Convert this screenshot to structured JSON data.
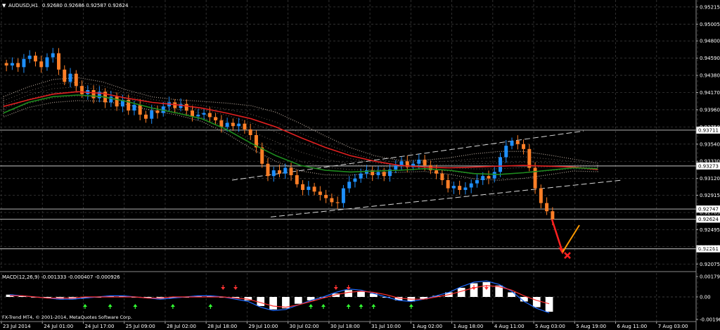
{
  "chart_header": {
    "symbol_label": "AUDUSD,H1",
    "ohlc_text": "0.92680 0.92686 0.92587 0.92624"
  },
  "watermark": "FX-Trend MT4, © 2001-2014, MetaQuotes Software Corp.",
  "chart_data": [
    {
      "type": "candlestick",
      "symbol": "AUDUSD",
      "timeframe": "H1",
      "last_bar": {
        "open": 0.9268,
        "high": 0.92686,
        "low": 0.92587,
        "close": 0.92624
      },
      "x_tick_labels": [
        "23 Jul 2014",
        "24 Jul 01:00",
        "24 Jul 17:00",
        "25 Jul 09:00",
        "28 Jul 02:00",
        "28 Jul 18:00",
        "29 Jul 10:00",
        "30 Jul 02:00",
        "30 Jul 18:00",
        "31 Jul 10:00",
        "1 Aug 02:00",
        "1 Aug 18:00",
        "4 Aug 11:00",
        "5 Aug 03:00",
        "5 Aug 19:00",
        "6 Aug 11:00",
        "7 Aug 03:00"
      ],
      "y_tick_labels": [
        "0.95215",
        "0.95005",
        "0.94800",
        "0.94590",
        "0.94380",
        "0.94170",
        "0.93960",
        "0.93750",
        "0.93540",
        "0.93330",
        "0.93120",
        "0.92915",
        "0.92705",
        "0.92495",
        "0.92285",
        "0.92075"
      ],
      "ylim": [
        0.92,
        0.953
      ],
      "horizontal_levels": [
        {
          "label": "0.93711",
          "value": 0.93711
        },
        {
          "label": "0.93273",
          "value": 0.93273
        },
        {
          "label": "0.92747",
          "value": 0.92747
        },
        {
          "label": "0.92624",
          "value": 0.92624
        },
        {
          "label": "0.92261",
          "value": 0.92261
        }
      ],
      "close_series": [
        0.945,
        0.9453,
        0.9448,
        0.9458,
        0.9462,
        0.9455,
        0.9448,
        0.946,
        0.9465,
        0.9445,
        0.943,
        0.944,
        0.9425,
        0.9415,
        0.942,
        0.941,
        0.9418,
        0.9405,
        0.9412,
        0.94,
        0.9408,
        0.9395,
        0.9402,
        0.939,
        0.9385,
        0.9395,
        0.9392,
        0.94,
        0.9405,
        0.9398,
        0.9403,
        0.9395,
        0.9388,
        0.939,
        0.9392,
        0.9387,
        0.9383,
        0.9375,
        0.938,
        0.9376,
        0.9379,
        0.9372,
        0.9365,
        0.935,
        0.933,
        0.9315,
        0.9322,
        0.9318,
        0.9325,
        0.9316,
        0.9305,
        0.9298,
        0.9302,
        0.9296,
        0.9292,
        0.9288,
        0.9283,
        0.9282,
        0.93,
        0.9308,
        0.9312,
        0.9318,
        0.9322,
        0.9316,
        0.932,
        0.9315,
        0.9323,
        0.9328,
        0.9333,
        0.9326,
        0.933,
        0.9335,
        0.9328,
        0.9322,
        0.9318,
        0.931,
        0.93,
        0.9303,
        0.9298,
        0.9301,
        0.9306,
        0.931,
        0.9315,
        0.9312,
        0.932,
        0.9338,
        0.9352,
        0.9358,
        0.9354,
        0.9348,
        0.9325,
        0.93,
        0.9282,
        0.9272,
        0.9262
      ],
      "moving_averages": [
        {
          "color": "#e02020",
          "values": [
            0.94,
            0.9408,
            0.9415,
            0.9418,
            0.9416,
            0.941,
            0.9405,
            0.9402,
            0.9398,
            0.9392,
            0.9385,
            0.9375,
            0.9362,
            0.935,
            0.934,
            0.9333,
            0.9328,
            0.9326,
            0.9325,
            0.9326,
            0.9327,
            0.9328,
            0.9327,
            0.9326,
            0.9323
          ]
        },
        {
          "color": "#1e8c1e",
          "values": [
            0.9392,
            0.9405,
            0.9412,
            0.9414,
            0.9412,
            0.9406,
            0.9398,
            0.9392,
            0.9385,
            0.9372,
            0.9355,
            0.934,
            0.9328,
            0.9322,
            0.932,
            0.9321,
            0.9322,
            0.9324,
            0.9322,
            0.9318,
            0.9317,
            0.9319,
            0.9322,
            0.9325,
            0.9324
          ]
        }
      ],
      "channel": {
        "lower_start": 0.9265,
        "lower_end": 0.931,
        "upper_start": 0.931,
        "upper_end": 0.937
      },
      "forecast": {
        "red_arrow_from": 0.9262,
        "red_arrow_to": 0.9222,
        "orange_line_from": 0.9222,
        "orange_line_to": 0.9255,
        "cross_marker": 0.9218
      }
    },
    {
      "type": "histogram",
      "indicator_label": "MACD(12,26,9) -0.001333 -0.000407 -0.000926",
      "y_tick_labels": [
        "0.001797",
        "0.00",
        "-0.001966"
      ],
      "ylim": [
        -0.0021,
        0.0021
      ],
      "histogram": [
        0.0002,
        0.0001,
        0.0,
        -0.0001,
        -0.0002,
        -0.0002,
        -0.0001,
        0.0,
        0.0001,
        0.0001,
        0.0,
        -0.0001,
        -0.0002,
        -0.0001,
        0.0,
        0.0001,
        0.0001,
        0.0,
        -0.0001,
        -0.0003,
        -0.0008,
        -0.0011,
        -0.001,
        -0.0006,
        -0.0003,
        0.0,
        0.0003,
        0.0006,
        0.0005,
        0.0003,
        0.0,
        -0.0003,
        -0.0004,
        -0.0002,
        0.0001,
        0.0004,
        0.0008,
        0.0012,
        0.0013,
        0.001,
        0.0004,
        -0.0004,
        -0.0009,
        -0.0013
      ],
      "signal_line": [
        0.0001,
        0.0001,
        0.0,
        -0.0001,
        -0.0001,
        -0.0001,
        0.0,
        0.0,
        0.0,
        0.0,
        0.0,
        -0.0001,
        -0.0001,
        0.0,
        0.0,
        0.0,
        0.0,
        0.0,
        -0.0001,
        -0.0002,
        -0.0005,
        -0.0008,
        -0.0009,
        -0.0007,
        -0.0004,
        -0.0001,
        0.0002,
        0.0004,
        0.0005,
        0.0004,
        0.0002,
        -0.0001,
        -0.0002,
        -0.0002,
        0.0,
        0.0002,
        0.0005,
        0.0008,
        0.001,
        0.0009,
        0.0006,
        0.0001,
        -0.0003,
        -0.0006
      ],
      "macd_line": [
        0.0002,
        0.0001,
        0.0,
        -0.0001,
        -0.0002,
        -0.0002,
        -0.0001,
        0.0,
        0.0001,
        0.0001,
        0.0,
        -0.0001,
        -0.0002,
        -0.0001,
        0.0,
        0.0001,
        0.0001,
        0.0,
        -0.0002,
        -0.0004,
        -0.0009,
        -0.0012,
        -0.0011,
        -0.0007,
        -0.0003,
        0.0,
        0.0004,
        0.0007,
        0.0006,
        0.0003,
        0.0,
        -0.0003,
        -0.0004,
        -0.0002,
        0.0001,
        0.0004,
        0.0009,
        0.0013,
        0.0014,
        0.0011,
        0.0005,
        -0.0004,
        -0.001,
        -0.0014
      ],
      "buy_arrows_green": [
        6,
        8,
        10,
        13,
        16,
        24,
        25,
        27,
        28,
        29,
        32
      ],
      "sell_arrows_red": [
        17,
        18,
        26,
        27,
        37,
        38
      ]
    }
  ],
  "colors": {
    "background": "#000000",
    "grid": "#3a3a3a",
    "bull_candle": "#1e90ff",
    "bear_candle": "#ff7f27",
    "cloud": "#e8d4c4",
    "level_line": "#c8c8c8",
    "forecast_arrow": "#ff2020",
    "forecast_line": "#ff9900",
    "macd_hist": "#ffffff",
    "macd_blue": "#1e6bff",
    "macd_red": "#ff3030"
  }
}
